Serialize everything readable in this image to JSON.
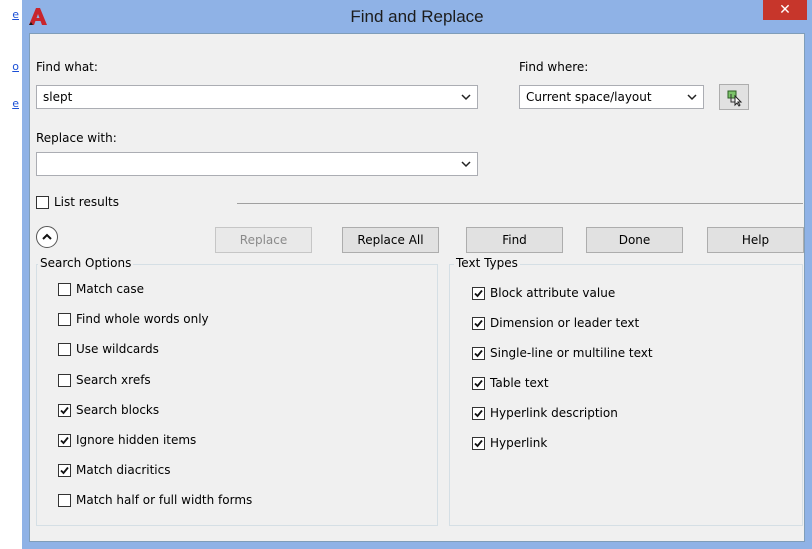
{
  "background_links": [
    "e",
    "o",
    "e"
  ],
  "dialog": {
    "title": "Find and Replace",
    "close_symbol": "✕"
  },
  "find_what": {
    "label": "Find what:",
    "value": "slept"
  },
  "find_where": {
    "label": "Find where:",
    "value": "Current space/layout"
  },
  "replace_with": {
    "label": "Replace with:",
    "value": ""
  },
  "list_results": {
    "label": "List results",
    "checked": false
  },
  "buttons": {
    "replace": "Replace",
    "replace_all": "Replace All",
    "find": "Find",
    "done": "Done",
    "help": "Help"
  },
  "search_options": {
    "title": "Search Options",
    "items": [
      {
        "label": "Match case",
        "checked": false
      },
      {
        "label": "Find whole words only",
        "checked": false
      },
      {
        "label": "Use wildcards",
        "checked": false
      },
      {
        "label": "Search xrefs",
        "checked": false
      },
      {
        "label": "Search blocks",
        "checked": true
      },
      {
        "label": "Ignore hidden items",
        "checked": true
      },
      {
        "label": "Match diacritics",
        "checked": true
      },
      {
        "label": "Match half or full width forms",
        "checked": false
      }
    ]
  },
  "text_types": {
    "title": "Text Types",
    "items": [
      {
        "label": "Block attribute value",
        "checked": true
      },
      {
        "label": "Dimension or leader text",
        "checked": true
      },
      {
        "label": "Single-line or multiline text",
        "checked": true
      },
      {
        "label": "Table text",
        "checked": true
      },
      {
        "label": "Hyperlink description",
        "checked": true
      },
      {
        "label": "Hyperlink",
        "checked": true
      }
    ]
  },
  "colors": {
    "title_bar": "#8fb2e6",
    "close_button": "#c7362b",
    "client_background": "#f0f0f0",
    "link": "#1a4fd6"
  },
  "icons": {
    "app": "autocad-logo-icon",
    "pick": "select-objects-icon",
    "collapse": "collapse-up-icon",
    "dropdown": "chevron-down-icon"
  }
}
